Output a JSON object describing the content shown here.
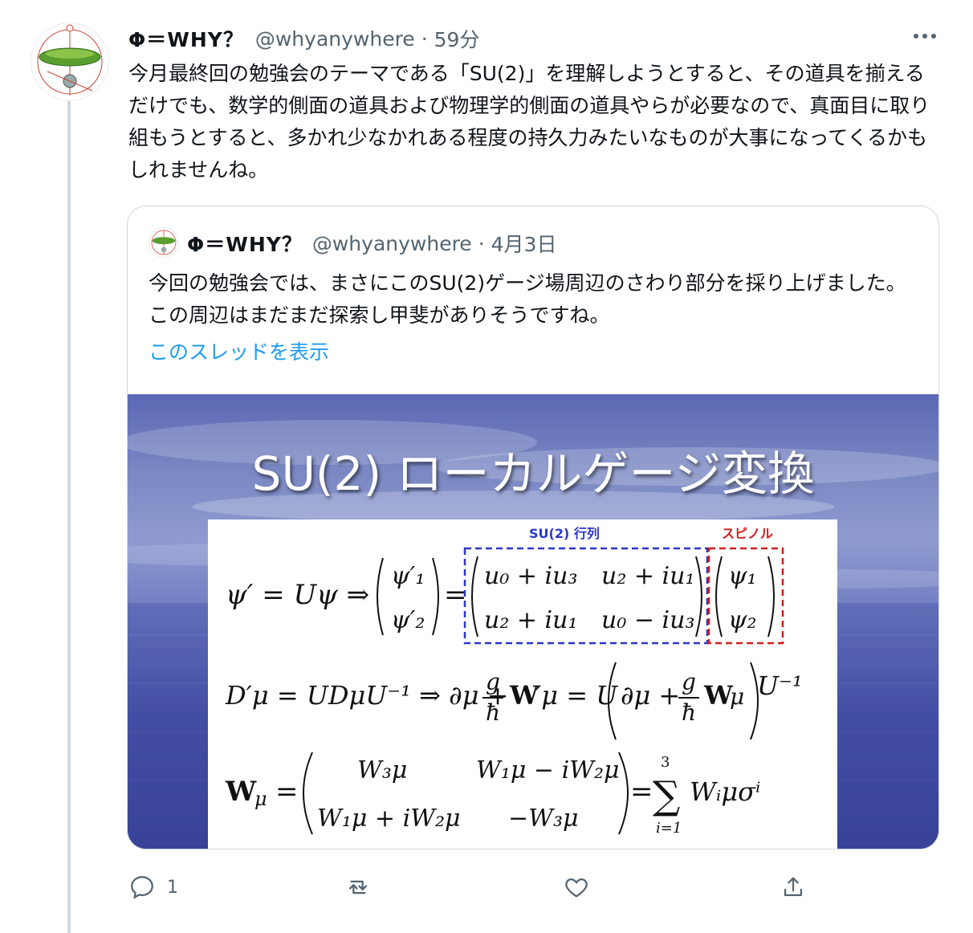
{
  "tweet": {
    "display_name": "Φ＝WHY？",
    "handle": "@whyanywhere",
    "separator": "·",
    "time": "59分",
    "text": "今月最終回の勉強会のテーマである「SU(2)」を理解しようとすると、その道具を揃えるだけでも、数学的側面の道具および物理学的側面の道具やらが必要なので、真面目に取り組もうとすると、多かれ少なかれある程度の持久力みたいなものが大事になってくるかもしれませんね。"
  },
  "quote": {
    "display_name": "Φ＝WHY？",
    "handle": "@whyanywhere",
    "separator": "·",
    "date": "4月3日",
    "text": "今回の勉強会では、まさにこのSU(2)ゲージ場周辺のさわり部分を採り上げました。この周辺はまだまだ探索し甲斐がありそうですね。",
    "show_thread": "このスレッドを表示",
    "slide": {
      "title": "SU(2) ローカルゲージ変換",
      "label_matrix": "SU(2) 行列",
      "label_spinor": "スピノル"
    }
  },
  "actions": {
    "reply_count": "1",
    "retweet_count": "",
    "like_count": ""
  },
  "colors": {
    "accent": "#1d9bf0",
    "muted": "#536471",
    "matrix_box": "#2a36c8",
    "spinor_box": "#d21d1d"
  },
  "icons": [
    "more-icon",
    "reply-icon",
    "retweet-icon",
    "like-icon",
    "share-icon"
  ]
}
